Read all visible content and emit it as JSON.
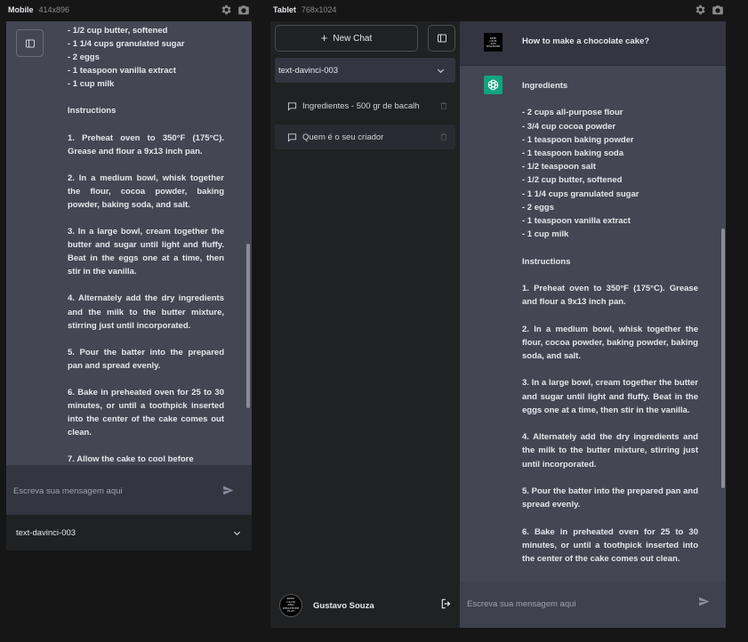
{
  "mobile_preview": {
    "label": "Mobile",
    "dims": "414x896",
    "content": {
      "lines_top": [
        "- 1/2 cup butter, softened",
        "- 1 1/4 cups granulated sugar",
        "- 2 eggs",
        "- 1 teaspoon vanilla extract",
        "- 1 cup milk"
      ],
      "instructions_heading": "Instructions",
      "steps": [
        "1. Preheat oven to 350°F (175°C). Grease and flour a 9x13 inch pan.",
        "2. In a medium bowl, whisk together the flour, cocoa powder, baking powder, baking soda, and salt.",
        "3. In a large bowl, cream together the butter and sugar until light and fluffy. Beat in the eggs one at a time, then stir in the vanilla.",
        "4. Alternately add the dry ingredients and the milk to the butter mixture, stirring just until incorporated.",
        "5. Pour the batter into the prepared pan and spread evenly.",
        "6. Bake in preheated oven for 25 to 30 minutes, or until a toothpick inserted into the center of the cake comes out clean.",
        "7. Allow the cake to cool before"
      ]
    },
    "input_placeholder": "Escreva sua mensagem aqui",
    "model_select": "text-davinci-003"
  },
  "tablet_preview": {
    "label": "Tablet",
    "dims": "768x1024",
    "sidebar": {
      "new_chat_label": "New Chat",
      "model_select": "text-davinci-003",
      "conversations": [
        {
          "title": "Ingredientes - 500 gr de bacalh"
        },
        {
          "title": "Quem é o seu criador"
        }
      ],
      "user_name": "Gustavo Souza",
      "avatar_lines": [
        "KEEP",
        "CALM",
        "AND",
        "WHATEVER",
        "PLAY"
      ]
    },
    "chat": {
      "user_question": "How to make a chocolate cake?",
      "answer": {
        "ingredients_heading": "Ingredients",
        "ingredients": [
          "- 2 cups all-purpose flour",
          "- 3/4 cup cocoa powder",
          "- 1 teaspoon baking powder",
          "- 1 teaspoon baking soda",
          "- 1/2 teaspoon salt",
          "- 1/2 cup butter, softened",
          "- 1 1/4 cups granulated sugar",
          "- 2 eggs",
          "- 1 teaspoon vanilla extract",
          "- 1 cup milk"
        ],
        "instructions_heading": "Instructions",
        "steps": [
          "1. Preheat oven to 350°F (175°C). Grease and flour a 9x13 inch pan.",
          "2. In a medium bowl, whisk together the flour, cocoa powder, baking powder, baking soda, and salt.",
          "3. In a large bowl, cream together the butter and sugar until light and fluffy. Beat in the eggs one at a time, then stir in the vanilla.",
          "4. Alternately add the dry ingredients and the milk to the butter mixture, stirring just until incorporated.",
          "5. Pour the batter into the prepared pan and spread evenly.",
          "6. Bake in preheated oven for 25 to 30 minutes, or until a toothpick inserted into the center of the cake comes out clean."
        ]
      },
      "input_placeholder": "Escreva sua mensagem aqui"
    }
  },
  "icons": {
    "settings": "gear-icon",
    "screenshot": "camera-icon",
    "sidebar_toggle": "sidebar-icon",
    "send": "send-icon",
    "chevron": "chevron-down-icon",
    "chat": "chat-bubble-icon",
    "delete": "trash-icon",
    "logout": "logout-icon",
    "bot": "openai-logo-icon"
  },
  "colors": {
    "bot_accent": "#10a37f",
    "chat_bg": "#444654",
    "sidebar_bg": "#202123",
    "main_bg": "#343541"
  }
}
